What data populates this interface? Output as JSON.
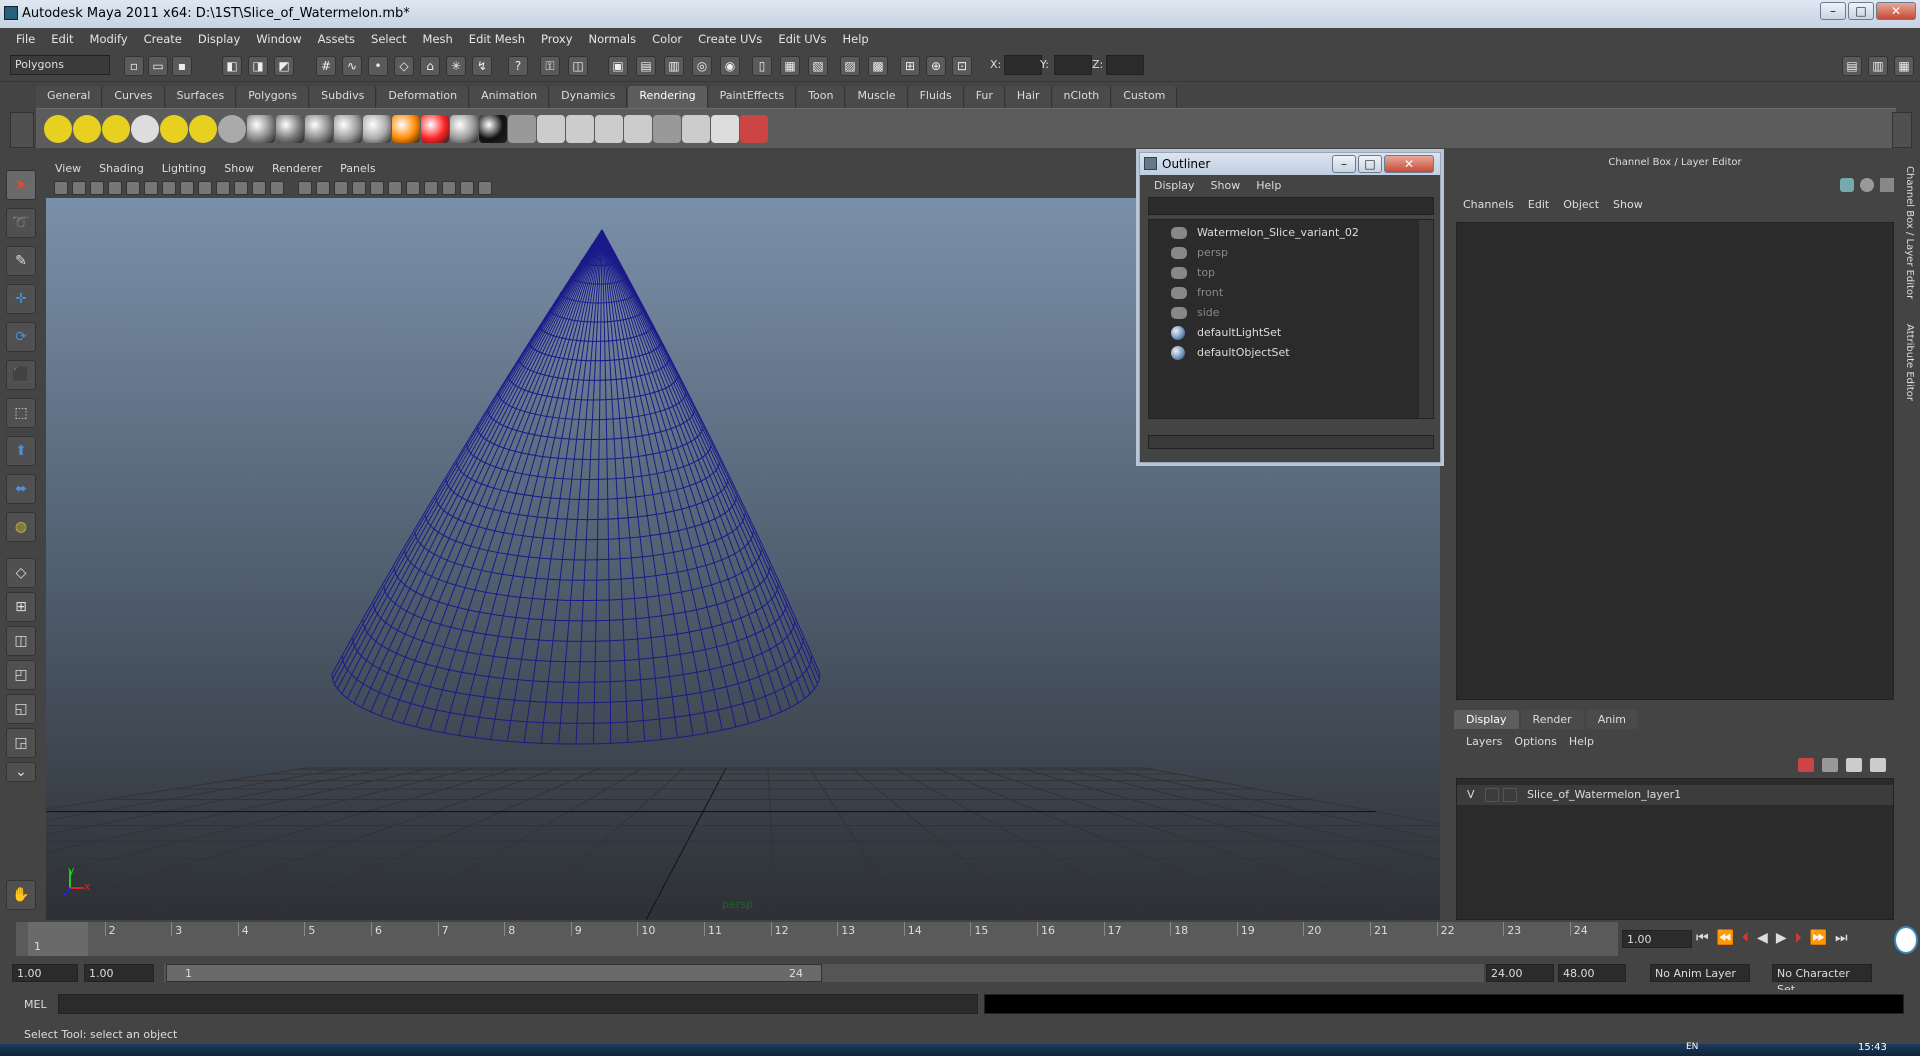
{
  "window": {
    "title": "Autodesk Maya 2011 x64: D:\\1ST\\Slice_of_Watermelon.mb*",
    "min": "–",
    "max": "□",
    "close": "✕"
  },
  "menubar": [
    "File",
    "Edit",
    "Modify",
    "Create",
    "Display",
    "Window",
    "Assets",
    "Select",
    "Mesh",
    "Edit Mesh",
    "Proxy",
    "Normals",
    "Color",
    "Create UVs",
    "Edit UVs",
    "Help"
  ],
  "statusline": {
    "mode": "Polygons",
    "x_label": "X:",
    "y_label": "Y:",
    "z_label": "Z:"
  },
  "shelf": {
    "tabs": [
      "General",
      "Curves",
      "Surfaces",
      "Polygons",
      "Subdivs",
      "Deformation",
      "Animation",
      "Dynamics",
      "Rendering",
      "PaintEffects",
      "Toon",
      "Muscle",
      "Fluids",
      "Fur",
      "Hair",
      "nCloth",
      "Custom"
    ],
    "active_tab": "Rendering",
    "icons": [
      "ambient-light-icon",
      "directional-light-icon",
      "point-light-icon",
      "spot-light-icon",
      "area-light-icon",
      "volume-light-icon",
      "camera-icon",
      "blinn-icon",
      "lambert-icon",
      "phong-icon",
      "phonge-icon",
      "anisotropic-icon",
      "layered-shader-icon",
      "ramp-shader-icon",
      "surface-shader-icon",
      "use-background-icon",
      "toon-shader-icon",
      "render-view-icon",
      "render-icon",
      "ipr-render-icon",
      "render-settings-icon",
      "hypershade-icon",
      "batch-render-icon",
      "fur-icon",
      "paint-icon"
    ]
  },
  "viewport": {
    "menu": [
      "View",
      "Shading",
      "Lighting",
      "Show",
      "Renderer",
      "Panels"
    ],
    "camera_label": "persp",
    "axis_y": "y",
    "axis_x": "x"
  },
  "outliner": {
    "title": "Outliner",
    "menu": [
      "Display",
      "Show",
      "Help"
    ],
    "items": [
      {
        "label": "Watermelon_Slice_variant_02",
        "dim": false,
        "icon": "mesh-group-icon"
      },
      {
        "label": "persp",
        "dim": true,
        "icon": "camera-icon"
      },
      {
        "label": "top",
        "dim": true,
        "icon": "camera-icon"
      },
      {
        "label": "front",
        "dim": true,
        "icon": "camera-icon"
      },
      {
        "label": "side",
        "dim": true,
        "icon": "camera-icon"
      },
      {
        "label": "defaultLightSet",
        "dim": false,
        "icon": "set-icon"
      },
      {
        "label": "defaultObjectSet",
        "dim": false,
        "icon": "set-icon"
      }
    ]
  },
  "channel_box": {
    "header": "Channel Box / Layer Editor",
    "menu": [
      "Channels",
      "Edit",
      "Object",
      "Show"
    ],
    "side_tabs": [
      "Channel Box / Layer Editor",
      "Attribute Editor"
    ]
  },
  "layer_editor": {
    "tabs": [
      "Display",
      "Render",
      "Anim"
    ],
    "active_tab": "Display",
    "menu": [
      "Layers",
      "Options",
      "Help"
    ],
    "layer": {
      "visible": "V",
      "name": "Slice_of_Watermelon_layer1"
    }
  },
  "time_slider": {
    "frames": [
      "1",
      "2",
      "3",
      "4",
      "5",
      "6",
      "7",
      "8",
      "9",
      "10",
      "11",
      "12",
      "13",
      "14",
      "15",
      "16",
      "17",
      "18",
      "19",
      "20",
      "21",
      "22",
      "23",
      "24"
    ],
    "current_frame": "1",
    "current_time": "1.00"
  },
  "range_slider": {
    "start": "1.00",
    "anim_start": "1.00",
    "range_min": "1",
    "range_max": "24",
    "anim_end": "24.00",
    "end": "48.00",
    "anim_layer": "No Anim Layer",
    "character_set": "No Character Set"
  },
  "command_line": {
    "label": "MEL"
  },
  "help_line": {
    "text": "Select Tool: select an object"
  },
  "taskbar": {
    "clock": "15:43",
    "lang": "EN"
  }
}
